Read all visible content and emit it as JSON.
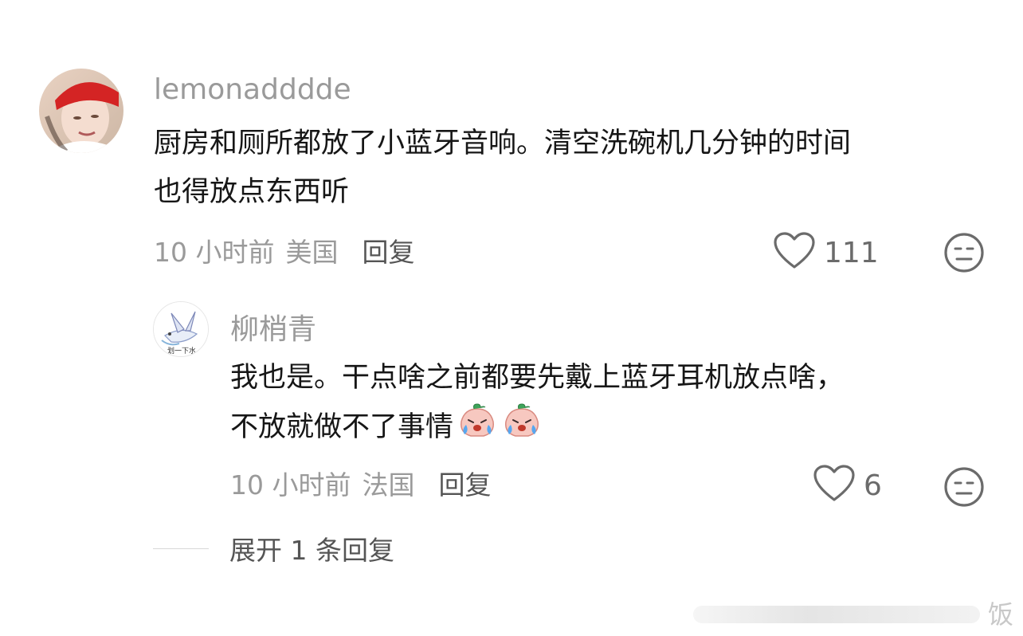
{
  "comments": [
    {
      "username": "lemonadddde",
      "text_line1": "厨房和厕所都放了小蓝牙音响。清空洗碗机几分钟的时间",
      "text_line2": "也得放点东西听",
      "time": "10 小时前",
      "location": "美国",
      "reply_label": "回复",
      "likes": "111",
      "avatar_icon": "user-avatar-red-cap",
      "like_icon": "heart-outline-icon",
      "dislike_icon": "neutral-face-icon"
    }
  ],
  "replies": [
    {
      "username": "柳梢青",
      "avatar_text": "划一下水",
      "text_line1": "我也是。干点啥之前都要先戴上蓝牙耳机放点啥，",
      "text_line2": "不放就做不了事情",
      "emojis": [
        "crying-peach-emoji",
        "crying-peach-emoji"
      ],
      "time": "10 小时前",
      "location": "法国",
      "reply_label": "回复",
      "likes": "6",
      "like_icon": "heart-outline-icon",
      "dislike_icon": "neutral-face-icon"
    }
  ],
  "expand": {
    "label": "展开 1 条回复"
  },
  "watermark": {
    "text": "饭"
  },
  "colors": {
    "meta": "#9a9a9a",
    "text": "#161616",
    "icon": "#6b6b6b"
  }
}
